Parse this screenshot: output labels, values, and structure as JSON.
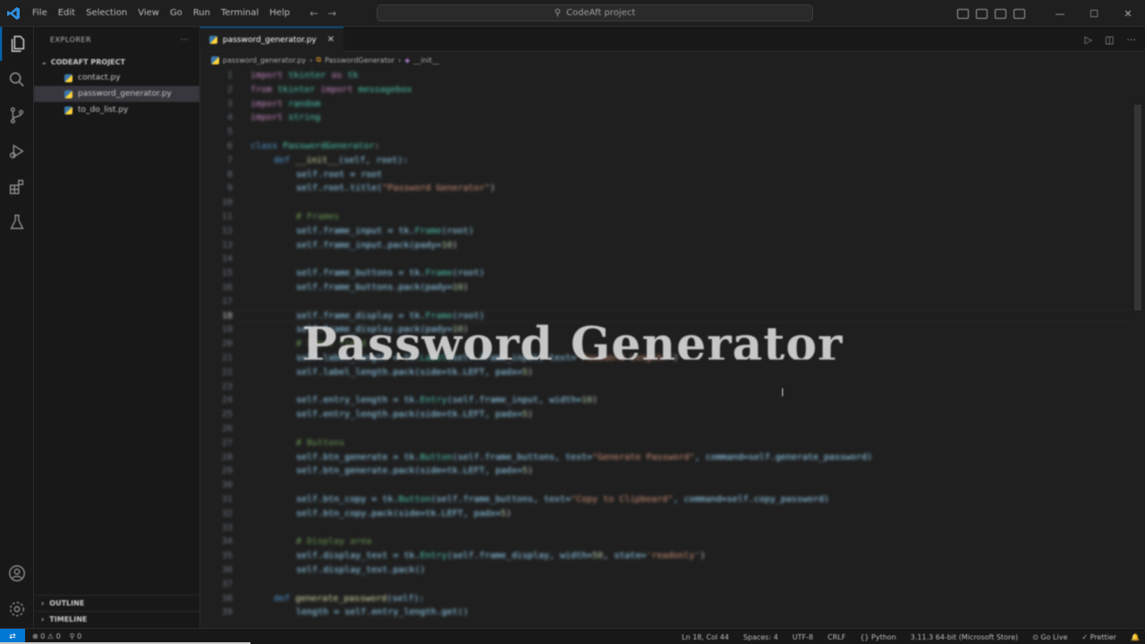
{
  "titlebar": {
    "menu": [
      "File",
      "Edit",
      "Selection",
      "View",
      "Go",
      "Run",
      "Terminal",
      "Help"
    ],
    "command_center": "CodeAft project"
  },
  "sidebar": {
    "title": "EXPLORER",
    "more": "···",
    "project": "CODEAFT PROJECT",
    "files": [
      {
        "name": "contact.py"
      },
      {
        "name": "password_generator.py"
      },
      {
        "name": "to_do_list.py"
      }
    ],
    "outline": "OUTLINE",
    "timeline": "TIMELINE"
  },
  "editor": {
    "tab": "password_generator.py",
    "breadcrumb": [
      "password_generator.py",
      "PasswordGenerator",
      "__init__"
    ],
    "overlay_title": "Password Generator"
  },
  "code_lines": [
    "1",
    "2",
    "3",
    "4",
    "5",
    "6",
    "7",
    "8",
    "9",
    "10",
    "11",
    "12",
    "13",
    "14",
    "15",
    "16",
    "17",
    "18",
    "19",
    "20",
    "21",
    "22",
    "23",
    "24",
    "25",
    "26",
    "27",
    "28",
    "29",
    "30",
    "31",
    "32",
    "33",
    "34",
    "35",
    "36",
    "37",
    "38",
    "39"
  ],
  "code": {
    "l1": [
      "import",
      " tkinter ",
      "as",
      " tk"
    ],
    "l2": [
      "from",
      " tkinter ",
      "import",
      " messagebox"
    ],
    "l3": [
      "import",
      " random"
    ],
    "l4": [
      "import",
      " string"
    ],
    "l6": [
      "class",
      " PasswordGenerator",
      ":"
    ],
    "l7": [
      "def",
      " __init__",
      "(self, root):"
    ],
    "l8": "self.root = root",
    "l9": [
      "self.root.title(",
      "\"Password Generator\"",
      ")"
    ],
    "l11": "# Frames",
    "l12": [
      "self.frame_input = tk.",
      "Frame",
      "(root)"
    ],
    "l13": [
      "self.frame_input.pack(pady=",
      "10",
      ")"
    ],
    "l15": [
      "self.frame_buttons = tk.",
      "Frame",
      "(root)"
    ],
    "l16": [
      "self.frame_buttons.pack(pady=",
      "10",
      ")"
    ],
    "l18": [
      "self.frame_display = tk.",
      "Frame",
      "(root)"
    ],
    "l19": [
      "self.frame_display.pack(pady=",
      "10",
      ")"
    ],
    "l20": "# Input field",
    "l21": [
      "self.label_length = tk.",
      "Label",
      "(self.frame_input, text=",
      "\"Password Length:\"",
      ")"
    ],
    "l22": [
      "self.label_length.pack(side=tk.LEFT, padx=",
      "5",
      ")"
    ],
    "l24": [
      "self.entry_length = tk.",
      "Entry",
      "(self.frame_input, width=",
      "10",
      ")"
    ],
    "l25": [
      "self.entry_length.pack(side=tk.LEFT, padx=",
      "5",
      ")"
    ],
    "l27": "# Buttons",
    "l28": [
      "self.btn_generate = tk.",
      "Button",
      "(self.frame_buttons, text=",
      "\"Generate Password\"",
      ", command=self.generate_password)"
    ],
    "l29": [
      "self.btn_generate.pack(side=tk.LEFT, padx=",
      "5",
      ")"
    ],
    "l31": [
      "self.btn_copy = tk.",
      "Button",
      "(self.frame_buttons, text=",
      "\"Copy to Clipboard\"",
      ", command=self.copy_password)"
    ],
    "l32": [
      "self.btn_copy.pack(side=tk.LEFT, padx=",
      "5",
      ")"
    ],
    "l34": "# Display area",
    "l35": [
      "self.display_text = tk.",
      "Entry",
      "(self.frame_display, width=",
      "50",
      ", state=",
      "'readonly'",
      ")"
    ],
    "l36": "self.display_text.pack()",
    "l38": [
      "def",
      " generate_password",
      "(self):"
    ],
    "l39": "length = self.entry_length.get()"
  },
  "statusbar": {
    "remote": "⇄",
    "errors": "⊗ 0  ⚠ 0",
    "ports": "⚲ 0",
    "position": "Ln 18, Col 44",
    "spaces": "Spaces: 4",
    "encoding": "UTF-8",
    "eol": "CRLF",
    "language": "{} Python",
    "interpreter": "3.11.3 64-bit (Microsoft Store)",
    "golive": "⊙ Go Live",
    "prettier": "✓ Prettier",
    "bell": "🔔"
  }
}
